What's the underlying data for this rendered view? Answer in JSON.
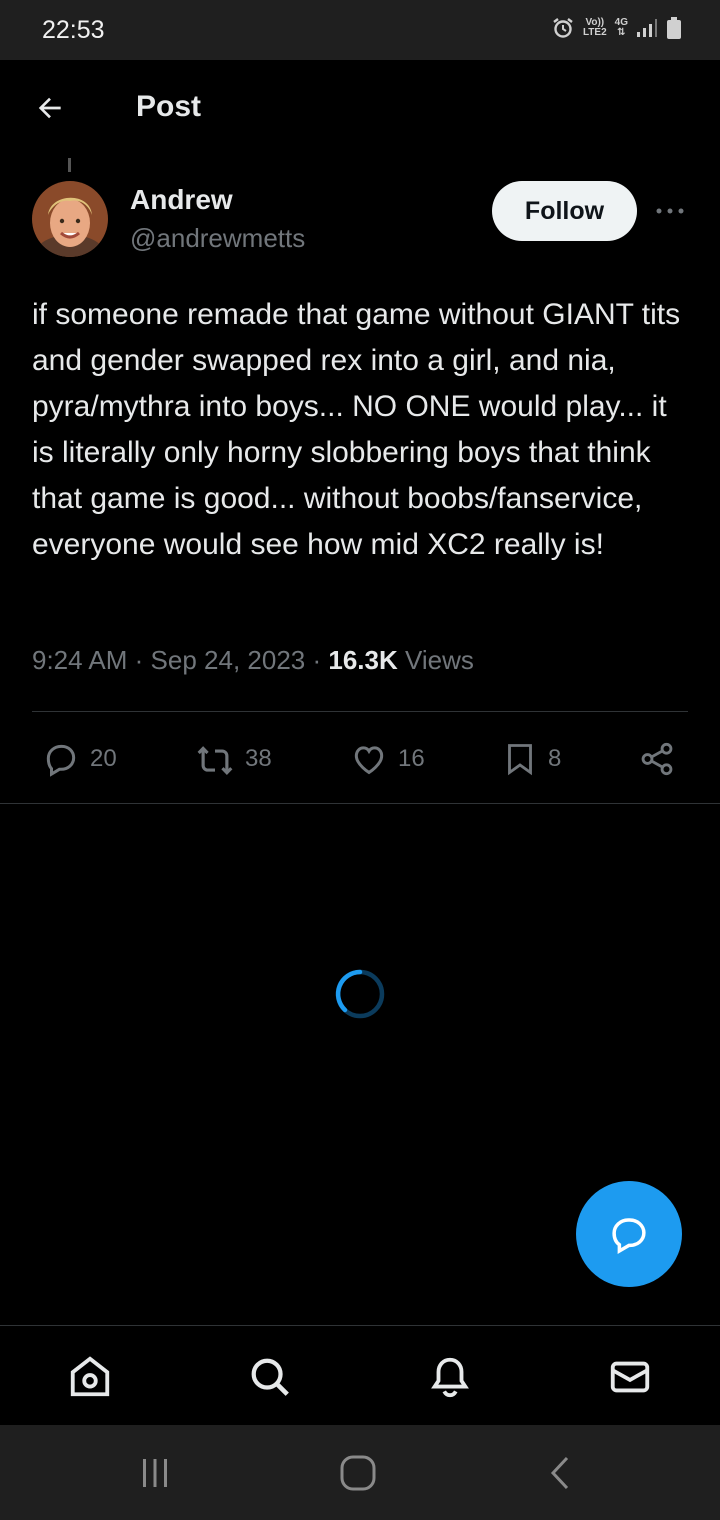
{
  "status_bar": {
    "time": "22:53",
    "network_top": "Vo))",
    "network_bottom": "LTE2",
    "signal_label": "4G",
    "icons": [
      "alarm-icon",
      "volte-icon",
      "4g-data-icon",
      "signal-icon",
      "battery-icon"
    ]
  },
  "header": {
    "title": "Post",
    "back_icon": "arrow-left-icon"
  },
  "post": {
    "author": {
      "name": "Andrew",
      "handle": "@andrewmetts"
    },
    "follow_label": "Follow",
    "more_icon": "more-horizontal-icon",
    "text": "if someone remade that game without GIANT tits and gender swapped rex into a girl, and nia, pyra/mythra into boys... NO ONE would play... it is literally only horny slobbering boys that think that game is good... without boobs/fanservice, everyone would see how mid XC2 really is!",
    "time": "9:24 AM",
    "date": "Sep 24, 2023",
    "separator": "·",
    "views_count": "16.3K",
    "views_label": "Views",
    "actions": {
      "replies": "20",
      "reposts": "38",
      "likes": "16",
      "bookmarks": "8"
    }
  },
  "fab_icon": "compose-reply-icon",
  "bottom_nav": [
    "home-icon",
    "search-icon",
    "notifications-icon",
    "messages-icon"
  ],
  "system_nav": [
    "recent-apps-icon",
    "home-button-icon",
    "back-icon"
  ],
  "colors": {
    "accent": "#1d9bf0",
    "background": "#000000",
    "text_primary": "#e7e9ea",
    "text_secondary": "#71767b",
    "divider": "#2f3336"
  }
}
